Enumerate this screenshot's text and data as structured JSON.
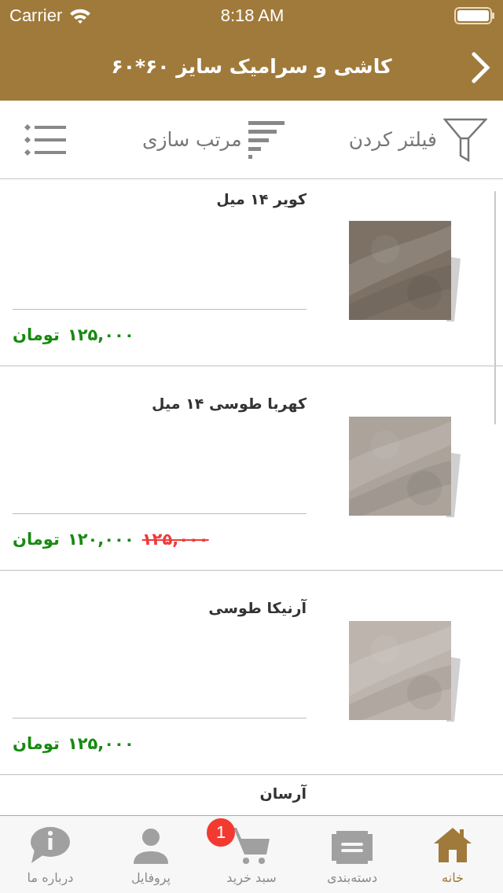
{
  "status_bar": {
    "carrier": "Carrier",
    "time": "8:18 AM"
  },
  "nav_bar": {
    "title": "کاشی و سرامیک سایز ۶۰*۶۰"
  },
  "toolbar": {
    "filter": "فیلتر کردن",
    "sort": "مرتب سازی"
  },
  "products": [
    {
      "name": "کویر ۱۴ میل",
      "price": "۱۲۵,۰۰۰",
      "currency": "تومان",
      "kind": "picture"
    },
    {
      "name": "کهربا طوسی ۱۴ میل",
      "old_price": "۱۲۵,۰۰۰",
      "price": "۱۲۰,۰۰۰",
      "currency": "تومان",
      "kind": "picture"
    },
    {
      "name": "آرنیکا طوسی",
      "price": "۱۲۵,۰۰۰",
      "currency": "تومان",
      "kind": "picture"
    },
    {
      "name": "آرسان"
    }
  ],
  "tab_bar": [
    {
      "kind": "home",
      "label": "خانه",
      "selected": true
    },
    {
      "kind": "categories",
      "label": "دسته‌بندی",
      "selected": false
    },
    {
      "kind": "cart",
      "label": "سبد خرید",
      "selected": false,
      "badge": "1"
    },
    {
      "kind": "profile",
      "label": "پروفایل",
      "selected": false
    },
    {
      "kind": "about",
      "label": "درباره ما",
      "selected": false
    }
  ]
}
